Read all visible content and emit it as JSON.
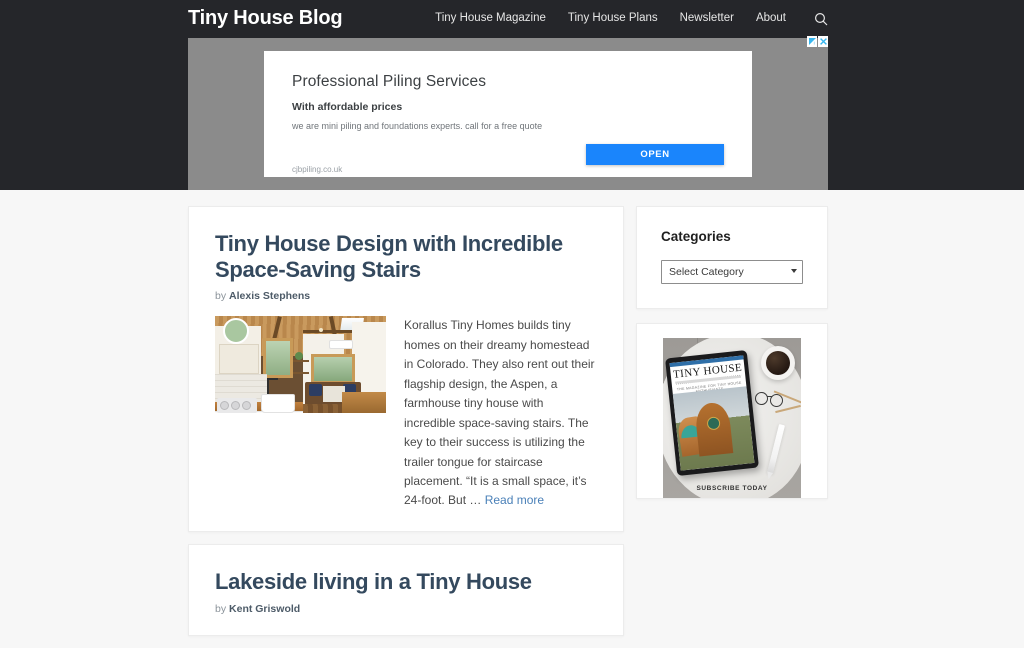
{
  "header": {
    "brand": "Tiny House Blog",
    "nav_items": [
      {
        "label": "Tiny House Magazine"
      },
      {
        "label": "Tiny House Plans"
      },
      {
        "label": "Newsletter"
      },
      {
        "label": "About"
      }
    ],
    "search_icon": "search-icon",
    "background_color": "#25262a"
  },
  "ad": {
    "adchoices_icon": "adchoices-icon",
    "close_icon": "close-icon",
    "headline": "Professional Piling Services",
    "subheadline": "With affordable prices",
    "body": "we are mini piling and foundations experts. call for a free quote",
    "display_url": "cjbpiling.co.uk",
    "cta_label": "OPEN",
    "cta_color": "#1a85fc",
    "backdrop_color": "#8b8b8b"
  },
  "articles": [
    {
      "title": "Tiny House Design with Incredible Space-Saving Stairs",
      "by_prefix": "by",
      "author": "Alexis Stephens",
      "thumbnail_alt": "tiny-house-interior-kitchen",
      "excerpt": "Korallus Tiny Homes builds tiny homes on their dreamy homestead in Colorado. They also rent out their flagship design, the Aspen, a farmhouse tiny house with incredible space-saving stairs. The key to their success is utilizing the trailer tongue for staircase placement. “It is a small space, it’s 24-foot. But … ",
      "read_more_label": "Read more"
    },
    {
      "title": "Lakeside living in a Tiny House",
      "by_prefix": "by",
      "author": "Kent Griswold"
    }
  ],
  "sidebar": {
    "categories_widget": {
      "title": "Categories",
      "select_value": "Select Category",
      "options": [
        "Select Category"
      ]
    },
    "promo_widget": {
      "magazine_title": "TINY HOUSE",
      "magazine_kicker": "THE MAGAZINE FOR TINY HOUSE ENTHUSIASTS",
      "subscribe_label": "SUBSCRIBE TODAY",
      "alt": "tiny-house-magazine-tablet-promo"
    }
  },
  "colors": {
    "page_background": "#f7f7f7",
    "card_background": "#ffffff",
    "title_color": "#34495e",
    "link_color": "#4a80b8"
  }
}
